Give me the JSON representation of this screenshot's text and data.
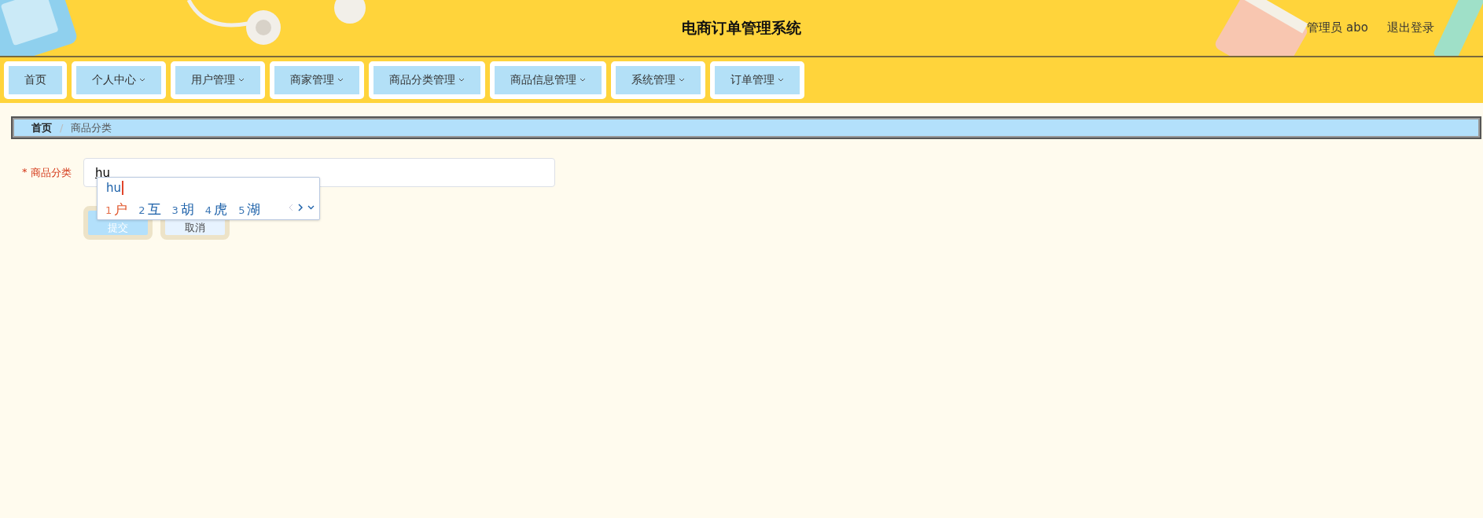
{
  "header": {
    "title": "电商订单管理系统",
    "user": "管理员 abo",
    "logout": "退出登录"
  },
  "nav": [
    {
      "label": "首页",
      "dropdown": false
    },
    {
      "label": "个人中心",
      "dropdown": true
    },
    {
      "label": "用户管理",
      "dropdown": true
    },
    {
      "label": "商家管理",
      "dropdown": true
    },
    {
      "label": "商品分类管理",
      "dropdown": true
    },
    {
      "label": "商品信息管理",
      "dropdown": true
    },
    {
      "label": "系统管理",
      "dropdown": true
    },
    {
      "label": "订单管理",
      "dropdown": true
    }
  ],
  "breadcrumb_separator": "/",
  "breadcrumb": [
    {
      "label": "首页",
      "current": false
    },
    {
      "label": "商品分类",
      "current": true
    }
  ],
  "form": {
    "fields": [
      {
        "label": "商品分类",
        "required_mark": "*",
        "value": "hu"
      }
    ],
    "buttons": [
      {
        "label": "提交",
        "kind": "primary"
      },
      {
        "label": "取消",
        "kind": "secondary"
      }
    ]
  },
  "ime": {
    "input": "hu",
    "candidates": [
      {
        "index": "1",
        "char": "户",
        "selected": true
      },
      {
        "index": "2",
        "char": "互",
        "selected": false
      },
      {
        "index": "3",
        "char": "胡",
        "selected": false
      },
      {
        "index": "4",
        "char": "虎",
        "selected": false
      },
      {
        "index": "5",
        "char": "湖",
        "selected": false
      }
    ]
  }
}
